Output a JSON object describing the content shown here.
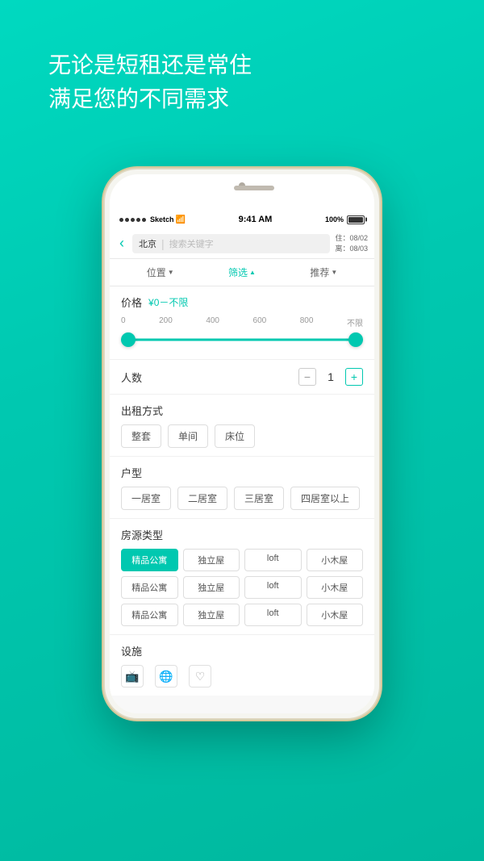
{
  "hero": {
    "line1": "无论是短租还是常住",
    "line2": "满足您的不同需求"
  },
  "status_bar": {
    "signal_label": "Sketch",
    "wifi_icon": "wifi",
    "time": "9:41 AM",
    "battery_label": "100%"
  },
  "search": {
    "city": "北京",
    "placeholder": "搜索关键字",
    "check_in": "住：08/02",
    "check_out": "离：08/03"
  },
  "filters": {
    "location": "位置",
    "filter": "筛选",
    "recommend": "推荐"
  },
  "price": {
    "label": "价格",
    "value": "¥0－不限",
    "marks": [
      "0",
      "200",
      "400",
      "600",
      "800",
      "不限"
    ]
  },
  "people": {
    "label": "人数",
    "count": "1"
  },
  "rental_type": {
    "label": "出租方式",
    "options": [
      "整套",
      "单间",
      "床位"
    ]
  },
  "room_type": {
    "label": "户型",
    "options": [
      "一居室",
      "二居室",
      "三居室",
      "四居室以上"
    ]
  },
  "source_type": {
    "label": "房源类型",
    "rows": [
      [
        "精品公寓",
        "独立屋",
        "loft",
        "小木屋"
      ],
      [
        "精品公寓",
        "独立屋",
        "loft",
        "小木屋"
      ],
      [
        "精品公寓",
        "独立屋",
        "loft",
        "小木屋"
      ]
    ],
    "selected_row": 0,
    "selected_col": 0
  },
  "facilities": {
    "label": "设施",
    "items": [
      {
        "icon": "📺",
        "label": "电视"
      },
      {
        "icon": "🌐",
        "label": "网络"
      },
      {
        "icon": "❤",
        "label": "收藏"
      }
    ]
  }
}
